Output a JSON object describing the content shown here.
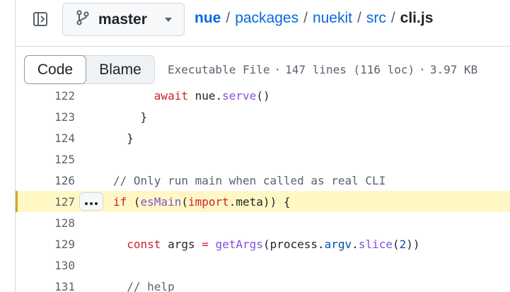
{
  "header": {
    "branch": "master",
    "breadcrumb": [
      "nue",
      "packages",
      "nuekit",
      "src"
    ],
    "current_file": "cli.js",
    "separator": "/"
  },
  "toolbar": {
    "code_label": "Code",
    "blame_label": "Blame",
    "file_type": "Executable File",
    "lines_info": "147 lines (116 loc)",
    "size": "3.97 KB",
    "dot": "·"
  },
  "code_lines": [
    {
      "num": "122",
      "tokens": [
        [
          "      ",
          ""
        ],
        [
          "await",
          "kw"
        ],
        [
          " nue.",
          ""
        ],
        [
          "serve",
          "fn"
        ],
        [
          "()",
          ""
        ]
      ]
    },
    {
      "num": "123",
      "tokens": [
        [
          "    }",
          ""
        ]
      ]
    },
    {
      "num": "124",
      "tokens": [
        [
          "  }",
          ""
        ]
      ]
    },
    {
      "num": "125",
      "tokens": []
    },
    {
      "num": "126",
      "tokens": [
        [
          "// Only run main when called as real CLI",
          "cm"
        ]
      ]
    },
    {
      "num": "127",
      "tokens": [
        [
          "if",
          "kw"
        ],
        [
          " (",
          ""
        ],
        [
          "esMain",
          "fn"
        ],
        [
          "(",
          ""
        ],
        [
          "import",
          "kw"
        ],
        [
          ".meta)) {",
          ""
        ]
      ],
      "highlighted": true
    },
    {
      "num": "128",
      "tokens": []
    },
    {
      "num": "129",
      "tokens": [
        [
          "  ",
          ""
        ],
        [
          "const",
          "kw"
        ],
        [
          " args ",
          ""
        ],
        [
          "=",
          "kw"
        ],
        [
          " ",
          ""
        ],
        [
          "getArgs",
          "fn"
        ],
        [
          "(process.",
          ""
        ],
        [
          "argv",
          "pr"
        ],
        [
          ".",
          ""
        ],
        [
          "slice",
          "fn"
        ],
        [
          "(",
          ""
        ],
        [
          "2",
          "num"
        ],
        [
          "))",
          ""
        ]
      ]
    },
    {
      "num": "130",
      "tokens": []
    },
    {
      "num": "131",
      "tokens": [
        [
          "  // help",
          "cm"
        ]
      ]
    }
  ],
  "colors": {
    "accent": "#0969da",
    "highlight": "#fff8c5",
    "highlight_bar": "#d4a72c"
  },
  "icons": {
    "panel": "sidebar-expand-icon",
    "branch": "git-branch-icon",
    "caret": "triangle-down-icon",
    "more": "kebab-horizontal-icon"
  }
}
